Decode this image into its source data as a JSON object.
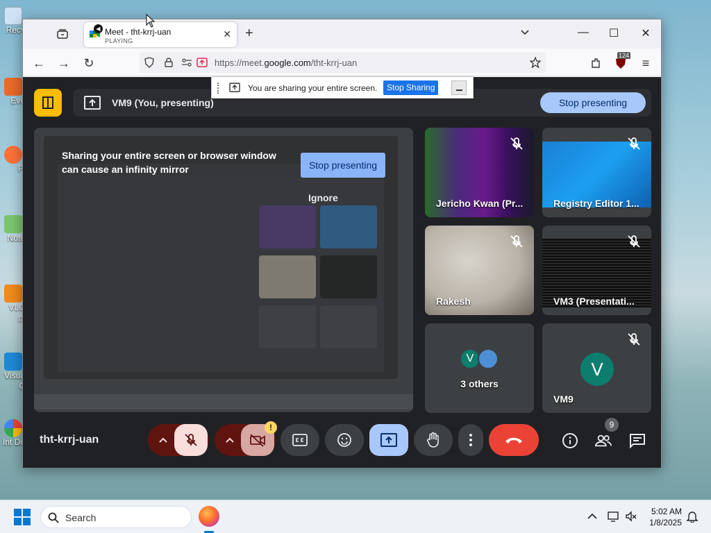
{
  "desktop": {
    "icons": [
      "Recy",
      "Eve",
      "Fi",
      "Note",
      "VLC pl",
      "Visua C",
      "Int Do"
    ]
  },
  "browser": {
    "tab": {
      "title": "Meet - tht-krrj-uan",
      "subtitle": "PLAYING"
    },
    "url_prefix": "https://meet.",
    "url_domain": "google.com",
    "url_path": "/tht-krrj-uan",
    "extension_badge": "124"
  },
  "share_bar": {
    "message": "You are sharing your entire screen.",
    "stop_label": "Stop Sharing"
  },
  "meet": {
    "banner_text": "VM9 (You, presenting)",
    "stop_presenting_label": "Stop presenting",
    "infinity_warning": "Sharing your entire screen or browser window can cause an infinity mirror",
    "infinity_stop_label": "Stop presenting",
    "infinity_ignore_label": "Ignore",
    "tiles": [
      {
        "name": "Jericho Kwan (Pr..."
      },
      {
        "name": "Registry Editor 1..."
      },
      {
        "name": "Rakesh"
      },
      {
        "name": "VM3 (Presentati..."
      },
      {
        "name": "3 others",
        "avatar_letter": "V"
      },
      {
        "name": "VM9",
        "avatar_letter": "V"
      }
    ],
    "meeting_code": "tht-krrj-uan",
    "camera_warning": "!",
    "participant_count": "9"
  },
  "taskbar": {
    "search_label": "Search",
    "time": "5:02 AM",
    "date": "1/8/2025"
  },
  "colors": {
    "meet_bg": "#202124",
    "accent_blue": "#a8c7fa",
    "end_call_red": "#ea4335",
    "mic_off_bg": "#f9dedc",
    "present_on_bg": "#a8c7fa",
    "logo_yellow": "#fbbc04"
  }
}
